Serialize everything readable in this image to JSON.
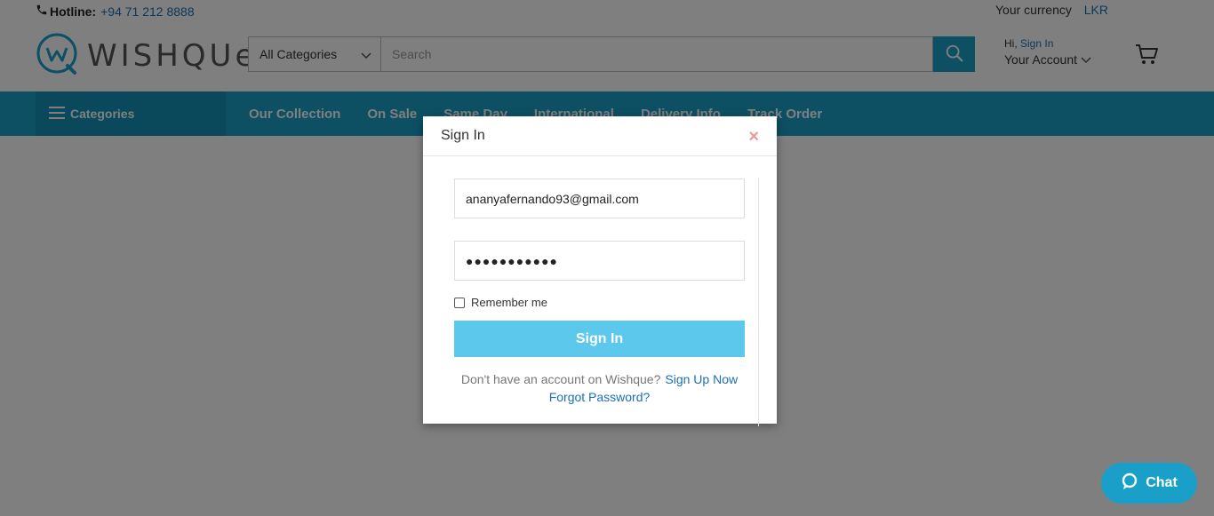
{
  "topbar": {
    "hotline_label": "Hotline:",
    "hotline_number": "+94 71 212 8888",
    "currency_label": "Your currency",
    "currency_value": "LKR"
  },
  "header": {
    "logo_text": "WISHQUe",
    "category_select": "All Categories",
    "search_placeholder": "Search",
    "greeting": "Hi,",
    "sign_in_link": "Sign In",
    "account_label": "Your Account"
  },
  "nav": {
    "categories_label": "Categories",
    "links": [
      "Our Collection",
      "On Sale",
      "Same Day",
      "International",
      "Delivery Info",
      "Track Order"
    ]
  },
  "modal": {
    "title": "Sign In",
    "email_value": "ananyafernando93@gmail.com",
    "password_value": "●●●●●●●●●●●",
    "remember_label": "Remember me",
    "signin_button": "Sign In",
    "no_account_text": "Don't have an account on Wishque?",
    "signup_link": "Sign Up Now",
    "forgot_link": "Forgot Password?"
  },
  "chat": {
    "label": "Chat"
  },
  "colors": {
    "brand": "#1aa0c8",
    "link": "#1a6fb5",
    "button": "#5bc8ec"
  },
  "icons": [
    "phone-icon",
    "wishque-logo-icon",
    "chevron-down-icon",
    "search-icon",
    "cart-icon",
    "menu-icon",
    "close-icon",
    "chat-bubble-icon"
  ]
}
